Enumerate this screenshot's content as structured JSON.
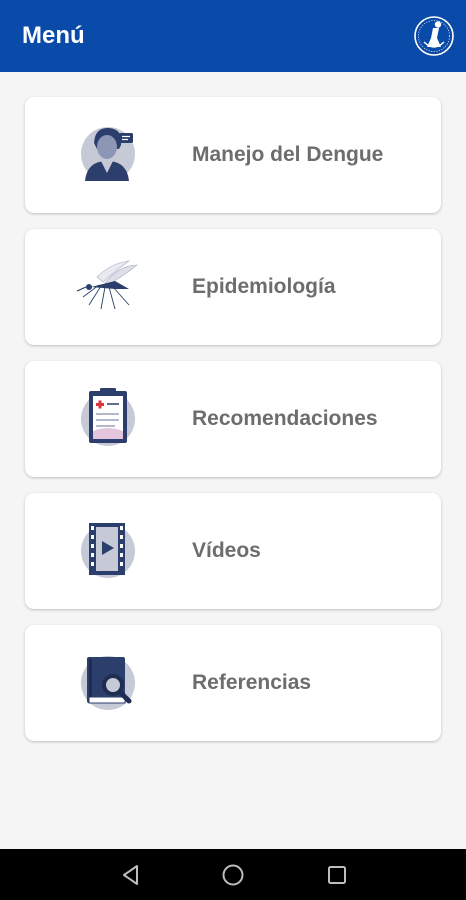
{
  "app_bar": {
    "title": "Menú",
    "background": "#0a4aa8",
    "logo_icon": "institution-seal-logo"
  },
  "menu": {
    "items": [
      {
        "label": "Manejo del Dengue",
        "icon": "doctor-icon"
      },
      {
        "label": "Epidemiología",
        "icon": "mosquito-icon"
      },
      {
        "label": "Recomendaciones",
        "icon": "clipboard-icon"
      },
      {
        "label": "Vídeos",
        "icon": "film-play-icon"
      },
      {
        "label": "Referencias",
        "icon": "book-search-icon"
      }
    ]
  },
  "nav_bar": {
    "buttons": [
      "back-icon",
      "home-icon",
      "recents-icon"
    ]
  },
  "colors": {
    "primary": "#0a4aa8",
    "icon_navy": "#2c3e6b",
    "label_gray": "#6d6d6d",
    "background": "#f5f5f5"
  }
}
